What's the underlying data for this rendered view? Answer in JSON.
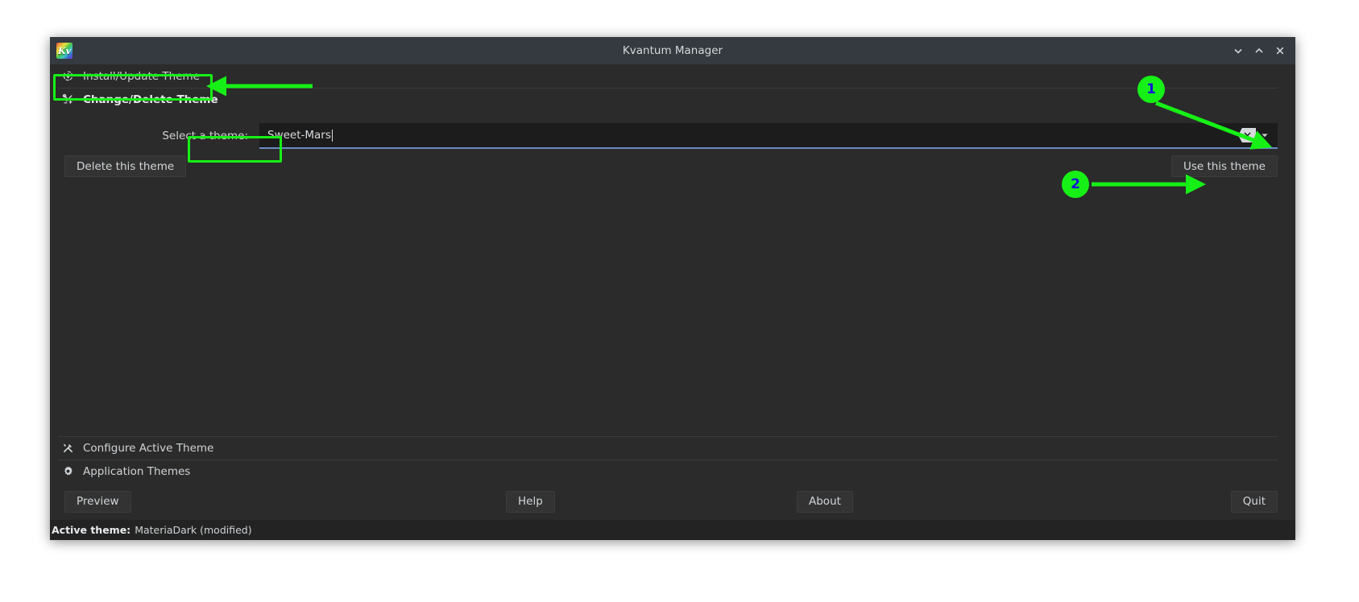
{
  "window": {
    "title": "Kvantum Manager",
    "app_icon": "kvantum-logo-icon",
    "icon_text": "Kv",
    "controls": {
      "minimize": "minimize-icon",
      "maximize": "maximize-icon",
      "close": "close-icon"
    }
  },
  "sections": {
    "install": {
      "label": "Install/Update Theme",
      "icon": "install-download-icon"
    },
    "change": {
      "label": "Change/Delete Theme",
      "icon": "theme-swap-icon"
    },
    "configure": {
      "label": "Configure Active Theme",
      "icon": "tools-icon"
    },
    "apps": {
      "label": "Application Themes",
      "icon": "gear-icon"
    }
  },
  "change_panel": {
    "select_label": "Select a theme:",
    "combo_value": "Sweet-Mars",
    "combo_placeholder": "Select a theme",
    "clear_icon": "clear-backspace-icon",
    "dropdown_icon": "chevron-down-icon",
    "delete_button": "Delete this theme",
    "use_button": "Use this theme"
  },
  "buttonbar": {
    "preview": "Preview",
    "help": "Help",
    "about": "About",
    "quit": "Quit"
  },
  "statusbar": {
    "label": "Active theme:",
    "value": "MateriaDark (modified)"
  },
  "annotations": {
    "badge1": "1",
    "badge2": "2",
    "accent_color": "#16f016",
    "badge_text_color": "#1414d8"
  }
}
